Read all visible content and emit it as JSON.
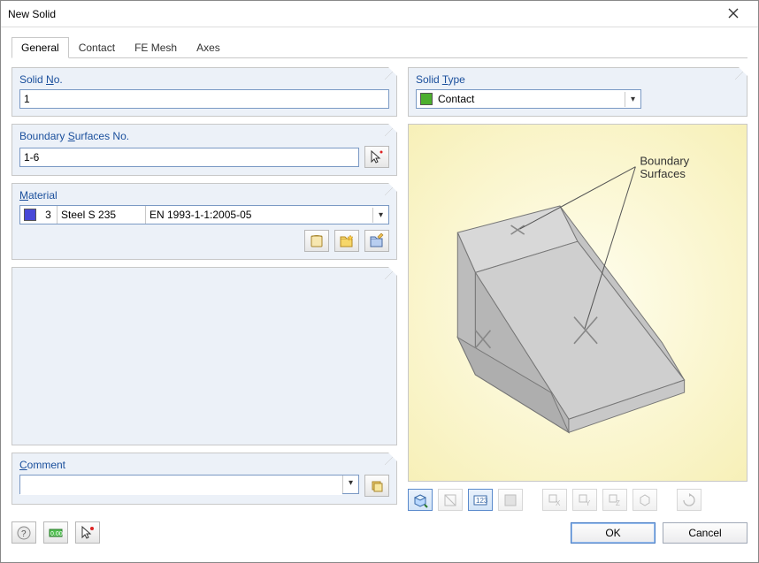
{
  "window": {
    "title": "New Solid"
  },
  "tabs": [
    "General",
    "Contact",
    "FE Mesh",
    "Axes"
  ],
  "active_tab": 0,
  "solid_no": {
    "label_pre": "Solid ",
    "label_u": "N",
    "label_post": "o.",
    "value": "1"
  },
  "boundary": {
    "label_pre": "Boundary ",
    "label_u": "S",
    "label_post": "urfaces No.",
    "value": "1-6"
  },
  "material": {
    "label_u": "M",
    "label_post": "aterial",
    "num": "3",
    "name": "Steel S 235",
    "spec": "EN 1993-1-1:2005-05",
    "swatch": "#3838c8"
  },
  "solid_type": {
    "label_pre": "Solid ",
    "label_u": "T",
    "label_post": "ype",
    "value": "Contact",
    "swatch": "#4caf2e"
  },
  "preview_label": "Boundary\nSurfaces",
  "comment": {
    "label_u": "C",
    "label_post": "omment",
    "value": ""
  },
  "buttons": {
    "ok": "OK",
    "cancel": "Cancel"
  }
}
